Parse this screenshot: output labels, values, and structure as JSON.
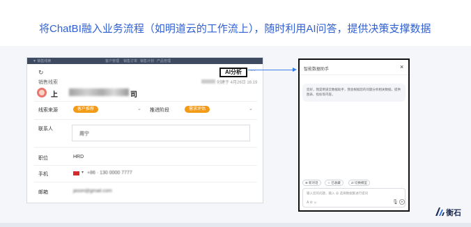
{
  "slide": {
    "title": "将ChatBI融入业务流程（如明道云的工作流上），随时利用AI问答，提供决策支撑数据"
  },
  "crm": {
    "nav": [
      "▼ 销售线索",
      "客户管理",
      "销售订单",
      "销售计划",
      "产品管理"
    ],
    "breadcrumb": "销售线索",
    "title_prefix": "上",
    "title_suffix": "司",
    "ai_button": "AI分析",
    "more": "···",
    "meta": "创建于 4月26日 16:19",
    "fields": {
      "source_label": "线索来源",
      "source_tag": "客户推荐",
      "stage_label": "推进阶段",
      "stage_tag": "需求评估",
      "contact_label": "联系人",
      "contact_value": "周宁",
      "position_label": "职位",
      "position_value": "HRD",
      "phone_label": "手机",
      "phone_value": "+86 · 130 0000 7777",
      "email_label": "邮箱",
      "email_value": "jason@gmail.com"
    }
  },
  "assistant": {
    "title": "智能数据助手",
    "close": "×",
    "greeting": "您好，我是明道云数据助手，我会根据您的问题分析相关数据，提供图表、指标等内容。",
    "chips": [
      "⊕ 新对话",
      "☆ 已收藏",
      "⇄ 切换模型"
    ],
    "input_placeholder": "输入您的问题，输入 @ 选择数据集进行提问",
    "input_tools": "A ⊘ ☺",
    "mic_icon": "🎙",
    "send_icon": "➤"
  },
  "brand": {
    "name": "衡石"
  },
  "colors": {
    "title_blue": "#2f5fd0",
    "tag_orange": "#f39a17",
    "arrow_blue": "#3c7ee8",
    "brand_navy": "#1f2c50"
  }
}
